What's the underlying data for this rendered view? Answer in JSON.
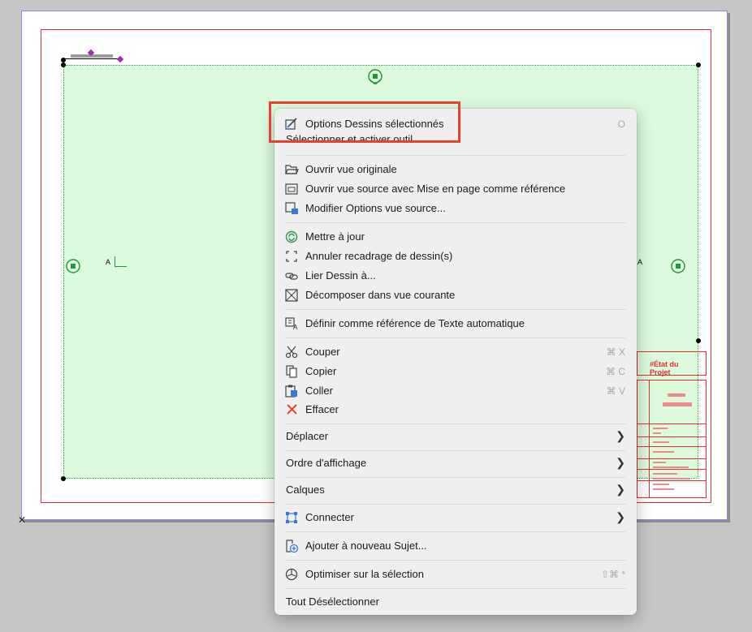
{
  "canvas": {
    "scale_marker": "A",
    "titleblock": {
      "state_label": "#État du Projet"
    }
  },
  "menu": {
    "items": [
      {
        "label": "Options Dessins sélectionnés",
        "shortcut": "O",
        "icon": "drawing-options-icon"
      },
      {
        "label": "Sélectionner et activer outil",
        "icon": ""
      },
      {
        "label": "Ouvrir vue originale",
        "icon": "open-folder-icon"
      },
      {
        "label": "Ouvrir vue source avec Mise en page comme référence",
        "icon": "view-source-icon"
      },
      {
        "label": "Modifier Options vue source...",
        "icon": "edit-view-options-icon"
      },
      {
        "label": "Mettre à jour",
        "icon": "update-icon"
      },
      {
        "label": "Annuler recadrage de dessin(s)",
        "icon": "crop-icon"
      },
      {
        "label": "Lier Dessin à...",
        "icon": "link-icon"
      },
      {
        "label": "Décomposer dans vue courante",
        "icon": "explode-icon"
      },
      {
        "label": "Définir comme référence de Texte automatique",
        "icon": "autotext-icon"
      },
      {
        "label": "Couper",
        "shortcut": "⌘ X",
        "icon": "scissors-icon"
      },
      {
        "label": "Copier",
        "shortcut": "⌘ C",
        "icon": "copy-icon"
      },
      {
        "label": "Coller",
        "shortcut": "⌘ V",
        "icon": "paste-icon"
      },
      {
        "label": "Effacer",
        "icon": "delete-icon"
      },
      {
        "label": "Déplacer",
        "submenu": true
      },
      {
        "label": "Ordre d'affichage",
        "submenu": true
      },
      {
        "label": "Calques",
        "submenu": true
      },
      {
        "label": "Connecter",
        "submenu": true,
        "icon": "connect-icon"
      },
      {
        "label": "Ajouter à nouveau Sujet...",
        "icon": "add-issue-icon"
      },
      {
        "label": "Optimiser sur la sélection",
        "shortcut": "⇧⌘ *",
        "icon": "zoom-selection-icon"
      },
      {
        "label": "Tout Désélectionner"
      }
    ]
  },
  "highlight_color": "#e8402f"
}
